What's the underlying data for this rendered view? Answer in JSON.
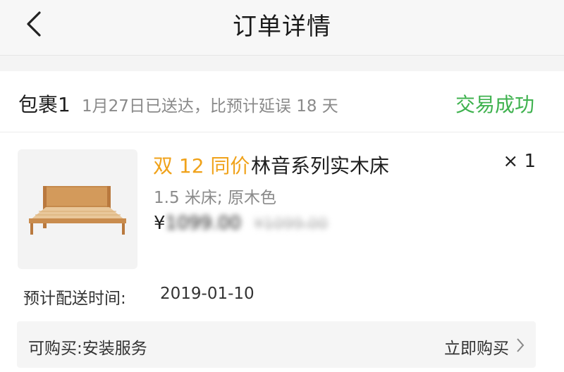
{
  "header": {
    "title": "订单详情",
    "back_icon": "chevron-left-icon"
  },
  "package": {
    "title": "包裹1",
    "delivery_note": "1月27日已送达，比预计延误 18 天",
    "status": "交易成功",
    "status_color": "#3fb24f"
  },
  "product": {
    "tag": "双 12 同价",
    "tag_color": "#f0a21a",
    "name": "林音系列实木床",
    "quantity": "× 1",
    "spec": "1.5 米床; 原木色",
    "price": "¥",
    "price_value": "1099.00",
    "original_price": "¥1099.00",
    "image_icon": "wooden-bed-image"
  },
  "delivery": {
    "label": "预计配送时间:",
    "date": "2019-01-10"
  },
  "service": {
    "label": "可购买:安装服务",
    "action": "立即购买",
    "chevron_icon": "chevron-right-icon"
  }
}
